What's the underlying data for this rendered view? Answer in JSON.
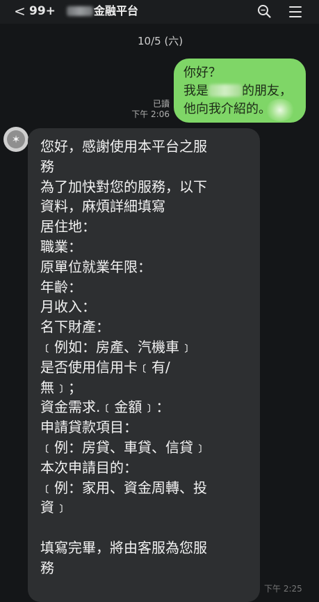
{
  "header": {
    "back_glyph": "<",
    "unread_count": "99+",
    "chat_title": "金融平台"
  },
  "date_chip": "10/5 (六)",
  "outgoing": {
    "line1": "你好？",
    "line2_pre": "我是",
    "line2_post": "的朋友，",
    "line3": "他向我介紹的。",
    "read_label": "已讀",
    "time": "下午 2:06"
  },
  "incoming": {
    "avatar_glyph": "✶",
    "lines": [
      "您好，感謝使用本平台之服",
      "務",
      "為了加快對您的服務，以下",
      "資料，麻煩詳細填寫",
      "居住地：",
      "職業：",
      "原單位就業年限：",
      "年齡：",
      "月收入：",
      "名下財產：",
      "﹝例如：房產、汽機車﹞",
      "是否使用信用卡﹝有/",
      "無﹞；",
      "資金需求.﹝金額﹞：",
      "申請貸款項目：",
      "﹝例：房貸、車貸、信貸﹞",
      "本次申請目的：",
      "﹝例：家用、資金周轉、投",
      "資﹞",
      "",
      "填寫完畢，將由客服為您服",
      "務"
    ],
    "time": "下午 2:25"
  }
}
